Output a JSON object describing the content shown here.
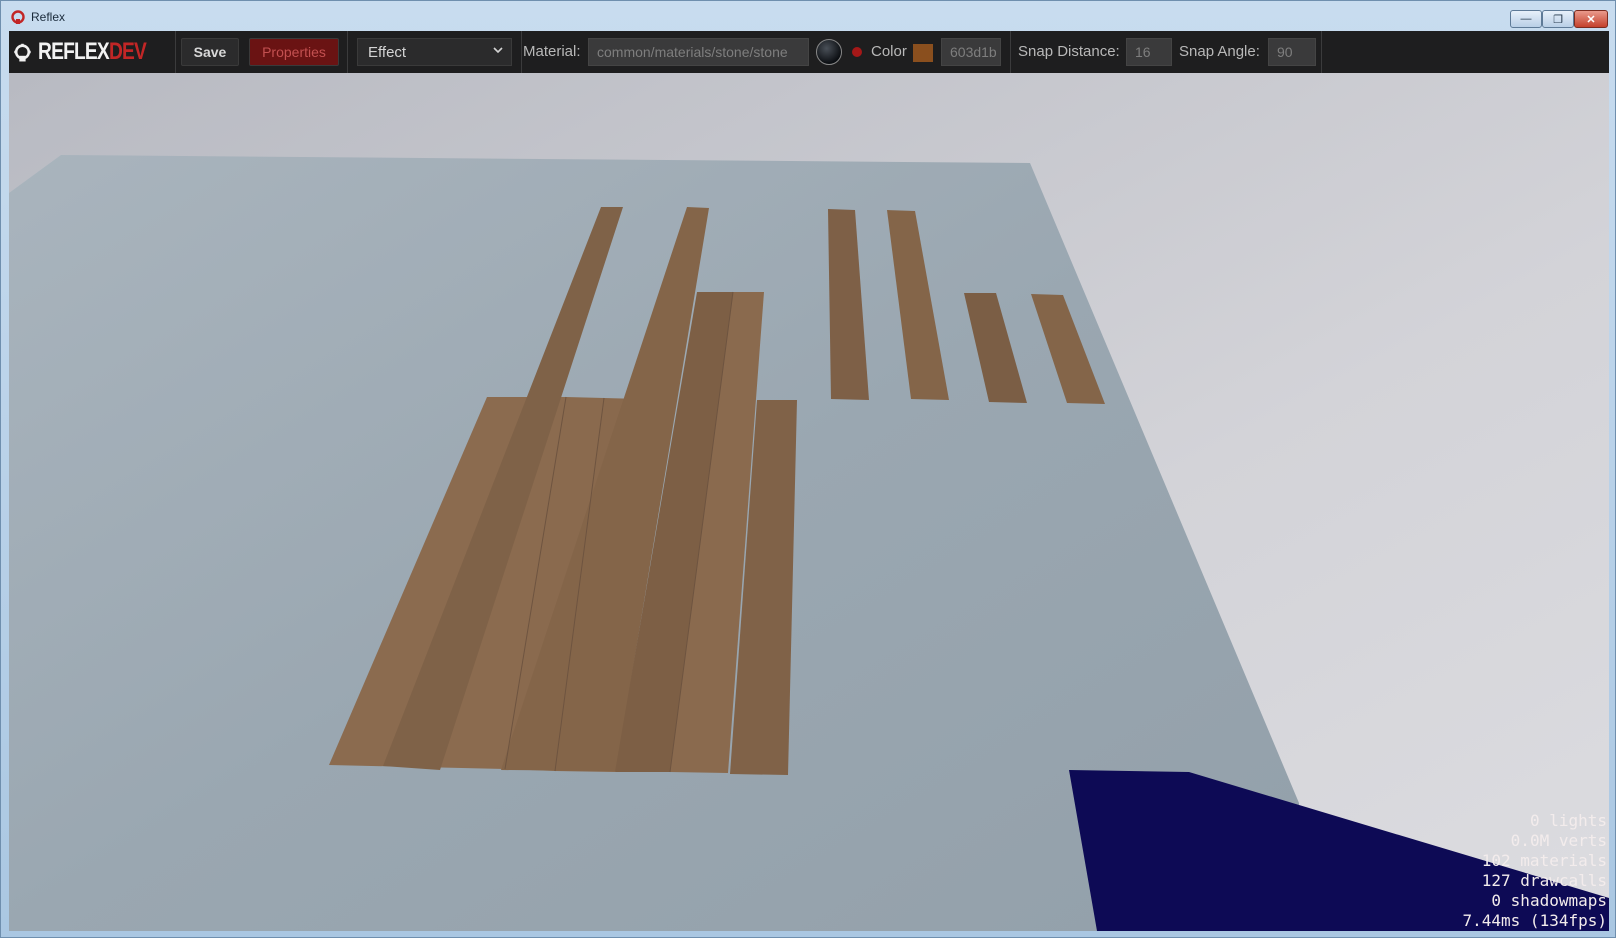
{
  "window": {
    "title": "Reflex"
  },
  "toolbar": {
    "logo": {
      "primary": "REFLEX",
      "accent": "DEV"
    },
    "save_label": "Save",
    "properties_label": "Properties",
    "effect_selected": "Effect",
    "material_label": "Material:",
    "material_value": "common/materials/stone/stone",
    "color_label": "Color",
    "color_hex": "603d1b",
    "color_swatch": "#8a4f1e",
    "snap_distance_label": "Snap Distance:",
    "snap_distance_value": "16",
    "snap_angle_label": "Snap Angle:",
    "snap_angle_value": "90"
  },
  "stats": {
    "lights": "0 lights",
    "verts": "0.0M verts",
    "materials": "102 materials",
    "drawcalls": "127 drawcalls",
    "shadowmaps": "0 shadowmaps",
    "frame": "7.44ms (134fps)"
  },
  "colors": {
    "accent": "#c22626",
    "plank": "#8a6a4e",
    "floor": "#9eaab4",
    "hand": "#0d0a55"
  }
}
